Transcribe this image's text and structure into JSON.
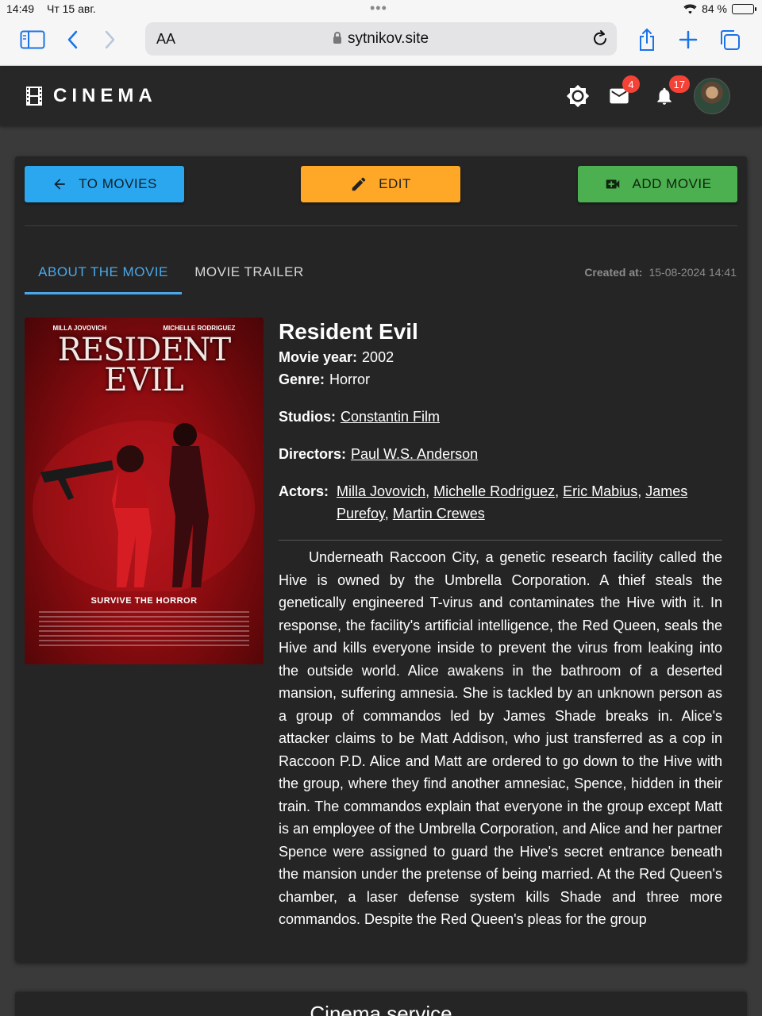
{
  "status_bar": {
    "time": "14:49",
    "date": "Чт 15 авг.",
    "battery": "84 %"
  },
  "browser": {
    "aa_label": "AA",
    "url": "sytnikov.site"
  },
  "header": {
    "brand": "CINEMA",
    "mail_count": "4",
    "notifications_count": "17"
  },
  "actions": {
    "back_label": "TO MOVIES",
    "edit_label": "EDIT",
    "add_label": "ADD MOVIE"
  },
  "tabs": [
    {
      "label": "ABOUT THE MOVIE"
    },
    {
      "label": "MOVIE TRAILER"
    }
  ],
  "created": {
    "label": "Created at:",
    "value": "15-08-2024 14:41"
  },
  "poster": {
    "names": [
      "MILLA JOVOVICH",
      "MICHELLE RODRIGUEZ"
    ],
    "title_line1": "RESIDENT",
    "title_line2": "EVIL",
    "tagline": "SURVIVE THE HORROR"
  },
  "movie": {
    "title": "Resident Evil",
    "year_label": "Movie year:",
    "year": "2002",
    "genre_label": "Genre:",
    "genre": "Horror",
    "studios_label": "Studios:",
    "studios": [
      "Constantin Film"
    ],
    "directors_label": "Directors:",
    "directors": [
      "Paul W.S. Anderson"
    ],
    "actors_label": "Actors:",
    "actors": [
      "Milla Jovovich",
      "Michelle Rodriguez",
      "Eric Mabius",
      "James Purefoy",
      "Martin Crewes"
    ],
    "description": "Underneath Raccoon City, a genetic research facility called the Hive is owned by the Umbrella Corporation. A thief steals the genetically engineered T-virus and contaminates the Hive with it. In response, the facility's artificial intelligence, the Red Queen, seals the Hive and kills everyone inside to prevent the virus from leaking into the outside world. Alice awakens in the bathroom of a deserted mansion, suffering amnesia. She is tackled by an unknown person as a group of commandos led by James Shade breaks in. Alice's attacker claims to be Matt Addison, who just transferred as a cop in Raccoon P.D. Alice and Matt are ordered to go down to the Hive with the group, where they find another amnesiac, Spence, hidden in their train. The commandos explain that everyone in the group except Matt is an employee of the Umbrella Corporation, and Alice and her partner Spence were assigned to guard the Hive's secret entrance beneath the mansion under the pretense of being married. At the Red Queen's chamber, a laser defense system kills Shade and three more commandos. Despite the Red Queen's pleas for the group"
  },
  "footer": {
    "title": "Cinema service"
  },
  "colors": {
    "back": "#2aa7ee",
    "edit": "#ffa726",
    "add": "#4caf50",
    "tab_active": "#4aa8ea",
    "badge": "#f44336"
  }
}
